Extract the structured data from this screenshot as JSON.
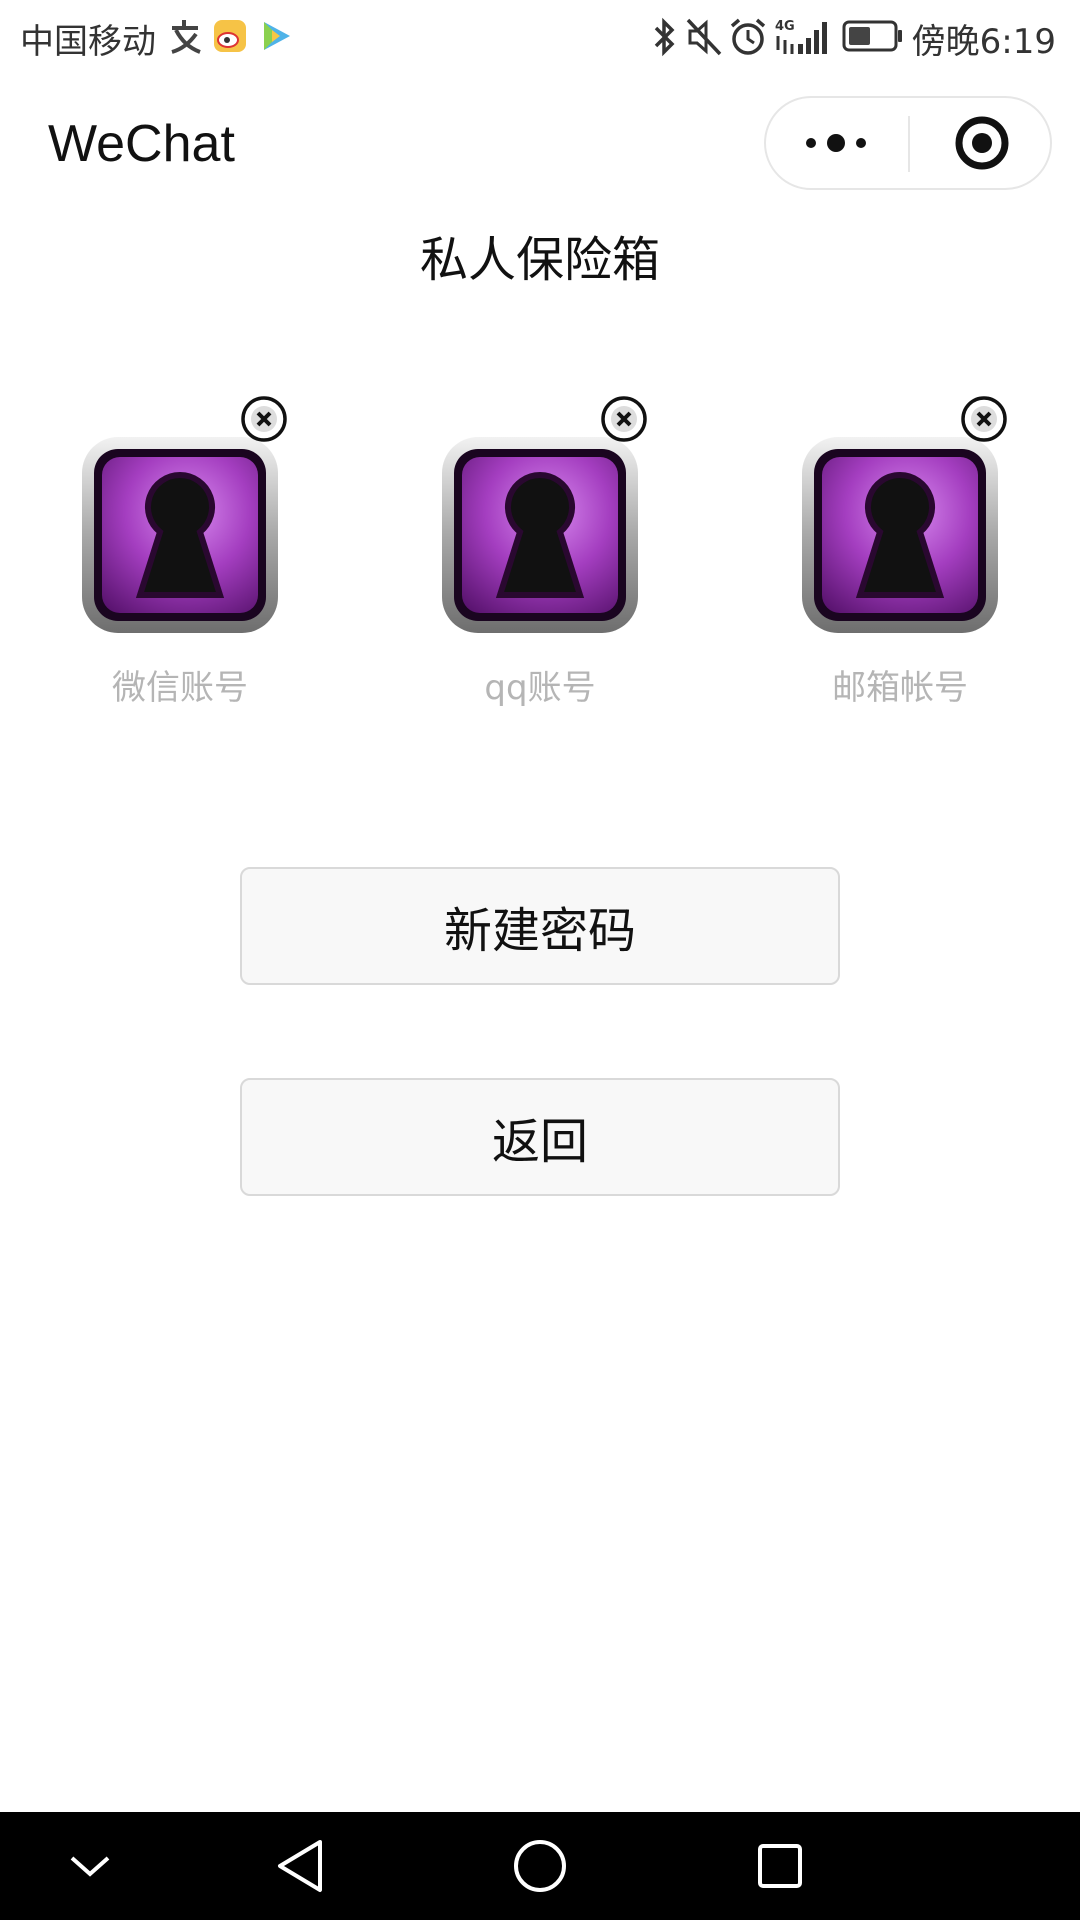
{
  "status_bar": {
    "carrier": "中国移动",
    "time": "傍晚6:19",
    "network": "4G",
    "battery_level": 0.5,
    "icons": [
      "alipay-icon",
      "weibo-icon",
      "video-icon",
      "bluetooth-icon",
      "mute-icon",
      "alarm-icon",
      "signal-icon",
      "battery-icon"
    ]
  },
  "header": {
    "title": "WeChat",
    "menu_icon": "more-dots-icon",
    "close_icon": "target-icon"
  },
  "page": {
    "title": "私人保险箱"
  },
  "vault": {
    "items": [
      {
        "label": "微信账号",
        "icon": "keyhole-lock-icon"
      },
      {
        "label": "qq账号",
        "icon": "keyhole-lock-icon"
      },
      {
        "label": "邮箱帐号",
        "icon": "keyhole-lock-icon"
      }
    ],
    "delete_icon": "close-circle-icon"
  },
  "actions": {
    "new_password": "新建密码",
    "back": "返回"
  },
  "colors": {
    "vault_purple": "#a43ec0",
    "label_gray": "#b5b5b5",
    "nav_bg": "#000000"
  }
}
